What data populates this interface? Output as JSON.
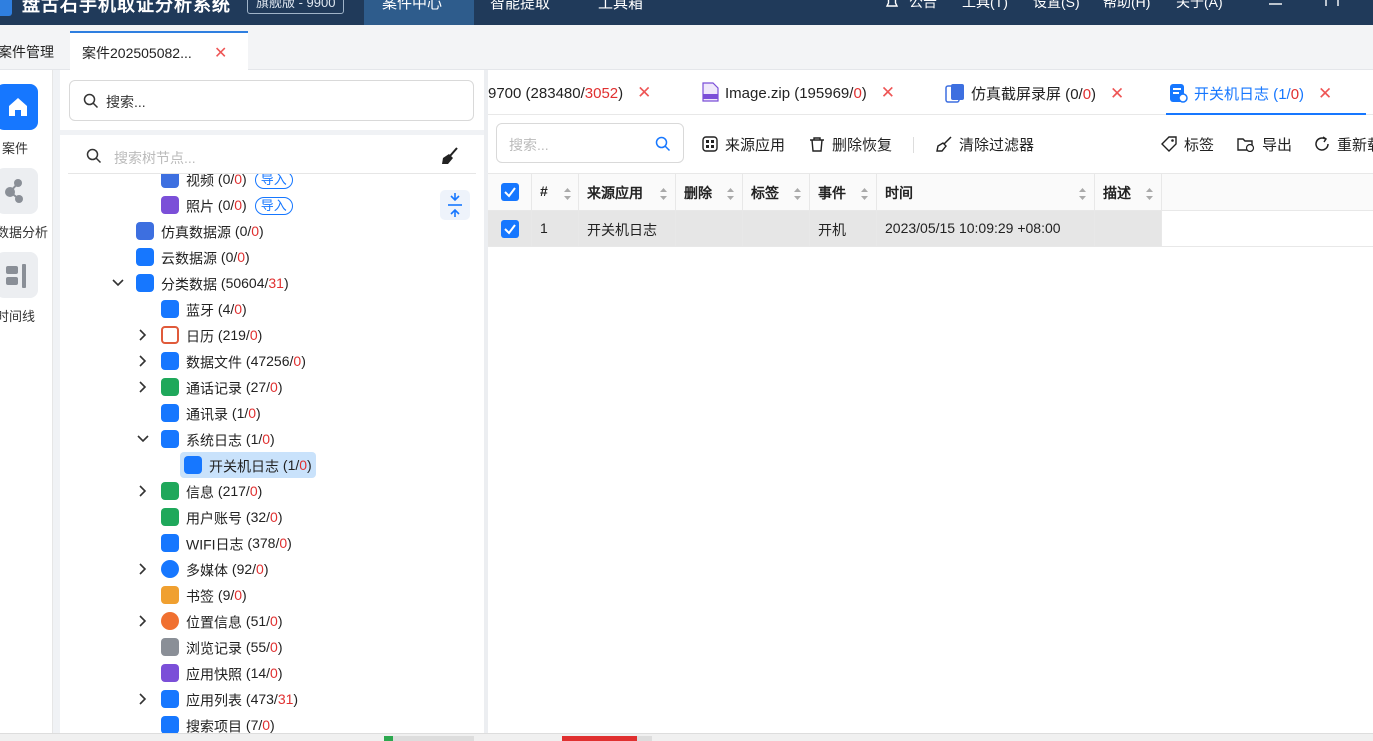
{
  "titlebar": {
    "app_title": "盘古石手机取证分析系统",
    "edition": "旗舰版 - 9900",
    "menus": [
      "案件中心",
      "智能提取",
      "工具箱"
    ],
    "right_menus": [
      "公告",
      "工具(T)",
      "设置(S)",
      "帮助(H)",
      "关于(A)"
    ]
  },
  "tabs": {
    "case_manage": "案件管理",
    "case_tab": "案件202505082..."
  },
  "leftnav": {
    "items": [
      {
        "label": "案件",
        "icon": "home-icon"
      },
      {
        "label": "数据分析",
        "icon": "graph-icon"
      },
      {
        "label": "时间线",
        "icon": "timeline-icon"
      }
    ]
  },
  "tree_panel": {
    "search_top": "搜索...",
    "search_tree_placeholder": "搜索树节点...",
    "import_label": "导入",
    "nodes": [
      {
        "label": "视频",
        "count": "0",
        "red": "0"
      },
      {
        "label": "照片",
        "count": "0",
        "red": "0"
      },
      {
        "label": "仿真数据源",
        "count": "0",
        "red": "0"
      },
      {
        "label": "云数据源",
        "count": "0",
        "red": "0"
      },
      {
        "label": "分类数据",
        "count": "50604",
        "red": "31"
      },
      {
        "label": "蓝牙",
        "count": "4",
        "red": "0"
      },
      {
        "label": "日历",
        "count": "219",
        "red": "0"
      },
      {
        "label": "数据文件",
        "count": "47256",
        "red": "0"
      },
      {
        "label": "通话记录",
        "count": "27",
        "red": "0"
      },
      {
        "label": "通讯录",
        "count": "1",
        "red": "0"
      },
      {
        "label": "系统日志",
        "count": "1",
        "red": "0"
      },
      {
        "label": "开关机日志",
        "count": "1",
        "red": "0"
      },
      {
        "label": "信息",
        "count": "217",
        "red": "0"
      },
      {
        "label": "用户账号",
        "count": "32",
        "red": "0"
      },
      {
        "label": "WIFI日志",
        "count": "378",
        "red": "0"
      },
      {
        "label": "多媒体",
        "count": "92",
        "red": "0"
      },
      {
        "label": "书签",
        "count": "9",
        "red": "0"
      },
      {
        "label": "位置信息",
        "count": "51",
        "red": "0"
      },
      {
        "label": "浏览记录",
        "count": "55",
        "red": "0"
      },
      {
        "label": "应用快照",
        "count": "14",
        "red": "0"
      },
      {
        "label": "应用列表",
        "count": "473",
        "red": "31"
      },
      {
        "label": "搜索项目",
        "count": "7",
        "red": "0"
      }
    ]
  },
  "data_tabs": [
    {
      "label": "9700",
      "count": "283480",
      "red": "3052"
    },
    {
      "label": "Image.zip",
      "count": "195969",
      "red": "0"
    },
    {
      "label": "仿真截屏录屏",
      "count": "0",
      "red": "0"
    },
    {
      "label": "开关机日志",
      "count": "1",
      "red": "0"
    }
  ],
  "toolbar": {
    "search_placeholder": "搜索...",
    "source_app": "来源应用",
    "delete_restore": "删除恢复",
    "clear_filter": "清除过滤器",
    "tag": "标签",
    "export": "导出",
    "reload": "重新载"
  },
  "table": {
    "columns": [
      "#",
      "来源应用",
      "删除",
      "标签",
      "事件",
      "时间",
      "描述"
    ],
    "rows": [
      {
        "num": "1",
        "source_app": "开关机日志",
        "deleted": "",
        "tag": "",
        "event": "开机",
        "time": "2023/05/15 10:09:29 +08:00",
        "desc": ""
      }
    ]
  },
  "colors": {
    "accent": "#1677ff",
    "titlebar": "#203a5a",
    "red": "#e03030"
  }
}
